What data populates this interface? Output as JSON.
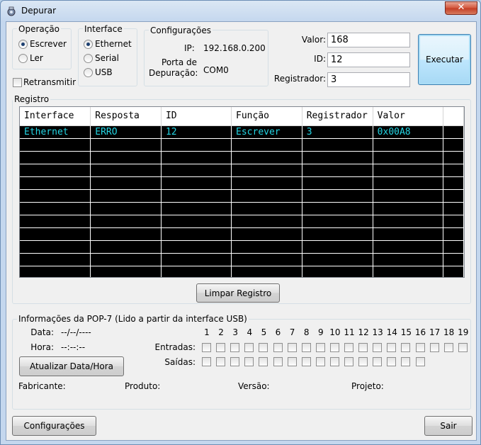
{
  "window": {
    "title": "Depurar",
    "close_label": "✕"
  },
  "operacao": {
    "title": "Operação",
    "options": [
      {
        "label": "Escrever",
        "selected": true
      },
      {
        "label": "Ler",
        "selected": false
      }
    ]
  },
  "interface": {
    "title": "Interface",
    "options": [
      {
        "label": "Ethernet",
        "selected": true
      },
      {
        "label": "Serial",
        "selected": false
      },
      {
        "label": "USB",
        "selected": false
      }
    ]
  },
  "retransmitir": {
    "label": "Retransmitir",
    "checked": false
  },
  "configuracoes": {
    "title": "Configurações",
    "ip_label": "IP:",
    "ip_value": "192.168.0.200",
    "porta_label_1": "Porta de",
    "porta_label_2": "Depuração:",
    "porta_value": "COM0"
  },
  "form": {
    "valor_label": "Valor:",
    "valor_value": "168",
    "id_label": "ID:",
    "id_value": "12",
    "registrador_label": "Registrador:",
    "registrador_value": "3",
    "executar_label": "Executar"
  },
  "registro": {
    "title": "Registro",
    "columns": [
      "Interface",
      "Resposta",
      "ID",
      "Função",
      "Registrador",
      "Valor"
    ],
    "rows": [
      [
        "Ethernet",
        "ERRO",
        "12",
        "Escrever",
        "3",
        "0x00A8"
      ]
    ],
    "limpar_label": "Limpar Registro"
  },
  "pop7": {
    "title": "Informações da POP-7 (Lido a partir da interface USB)",
    "data_label": "Data:",
    "data_value": "--/--/----",
    "hora_label": "Hora:",
    "hora_value": "--:--:--",
    "atualizar_label": "Atualizar Data/Hora",
    "pin_numbers": [
      "1",
      "2",
      "3",
      "4",
      "5",
      "6",
      "7",
      "8",
      "9",
      "10",
      "11",
      "12",
      "13",
      "14",
      "15",
      "16",
      "17",
      "18",
      "19"
    ],
    "entradas_label": "Entradas:",
    "saidas_label": "Saídas:",
    "entradas_count": 19,
    "saidas_count": 16,
    "fabricante_label": "Fabricante:",
    "produto_label": "Produto:",
    "versao_label": "Versão:",
    "projeto_label": "Projeto:"
  },
  "footer": {
    "configuracoes_label": "Configurações",
    "sair_label": "Sair"
  }
}
